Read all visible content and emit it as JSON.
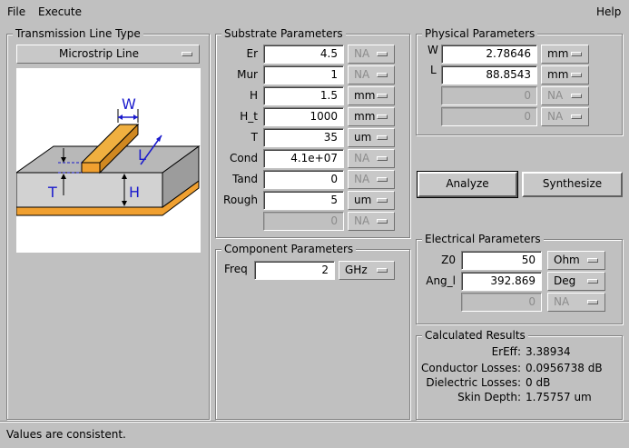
{
  "menubar": {
    "file_label": "File",
    "execute_label": "Execute",
    "help_label": "Help"
  },
  "transmission": {
    "title": "Transmission Line Type",
    "selected": "Microstrip Line",
    "diagram_labels": {
      "w": "W",
      "l": "L",
      "t": "T",
      "h": "H"
    }
  },
  "substrate": {
    "title": "Substrate Parameters",
    "rows": [
      {
        "label": "Er",
        "value": "4.5",
        "unit": "NA"
      },
      {
        "label": "Mur",
        "value": "1",
        "unit": "NA"
      },
      {
        "label": "H",
        "value": "1.5",
        "unit": "mm"
      },
      {
        "label": "H_t",
        "value": "1000",
        "unit": "mm"
      },
      {
        "label": "T",
        "value": "35",
        "unit": "um"
      },
      {
        "label": "Cond",
        "value": "4.1e+07",
        "unit": "NA"
      },
      {
        "label": "Tand",
        "value": "0",
        "unit": "NA"
      },
      {
        "label": "Rough",
        "value": "5",
        "unit": "um"
      },
      {
        "label": "",
        "value": "0",
        "unit": "NA"
      }
    ]
  },
  "component": {
    "title": "Component Parameters",
    "freq_label": "Freq",
    "freq_value": "2",
    "freq_unit": "GHz"
  },
  "physical": {
    "title": "Physical Parameters",
    "rows": [
      {
        "label": "W",
        "value": "2.78646",
        "unit": "mm"
      },
      {
        "label": "L",
        "value": "88.8543",
        "unit": "mm"
      },
      {
        "label": "",
        "value": "0",
        "unit": "NA"
      },
      {
        "label": "",
        "value": "0",
        "unit": "NA"
      }
    ]
  },
  "actions": {
    "analyze_label": "Analyze",
    "synthesize_label": "Synthesize"
  },
  "electrical": {
    "title": "Electrical Parameters",
    "rows": [
      {
        "label": "Z0",
        "value": "50",
        "unit": "Ohm"
      },
      {
        "label": "Ang_l",
        "value": "392.869",
        "unit": "Deg"
      },
      {
        "label": "",
        "value": "0",
        "unit": "NA"
      }
    ]
  },
  "results": {
    "title": "Calculated Results",
    "rows": [
      {
        "label": "ErEff:",
        "value": "3.38934"
      },
      {
        "label": "Conductor Losses:",
        "value": "0.0956738 dB"
      },
      {
        "label": "Dielectric Losses:",
        "value": "0 dB"
      },
      {
        "label": "Skin Depth:",
        "value": "1.75757 um"
      }
    ]
  },
  "status": {
    "message": "Values are consistent."
  }
}
